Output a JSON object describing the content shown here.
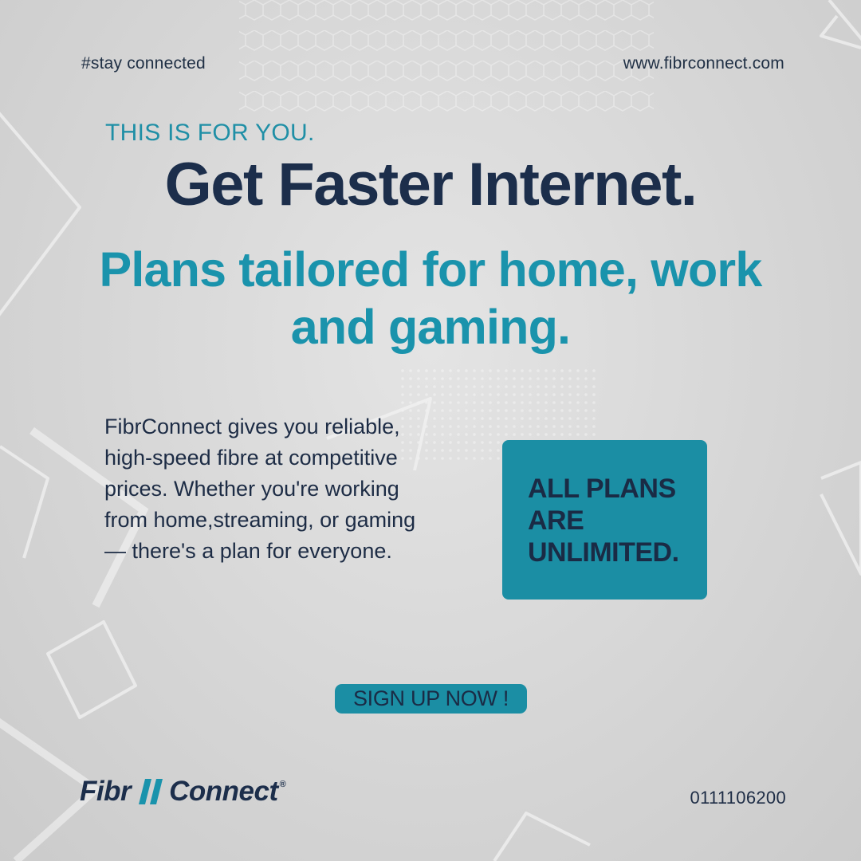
{
  "header": {
    "hashtag": "#stay connected",
    "website": "www.fibrconnect.com"
  },
  "hero": {
    "kicker": "THIS IS FOR YOU.",
    "headline": "Get Faster Internet.",
    "subheadline": "Plans tailored for home, work and gaming."
  },
  "body": {
    "text": "FibrConnect gives you reliable, high-speed fibre at competitive prices. Whether you're working from home,streaming, or gaming — there's a plan for everyone."
  },
  "callout": {
    "text": "ALL PLANS ARE UNLIMITED."
  },
  "cta": {
    "label": "SIGN UP NOW !"
  },
  "footer": {
    "logo_left": "Fibr",
    "logo_right": "Connect",
    "logo_reg": "®",
    "phone": "0111106200"
  },
  "colors": {
    "navy": "#1c2e4b",
    "teal": "#1a93ac",
    "background": "#d8d8d8"
  }
}
